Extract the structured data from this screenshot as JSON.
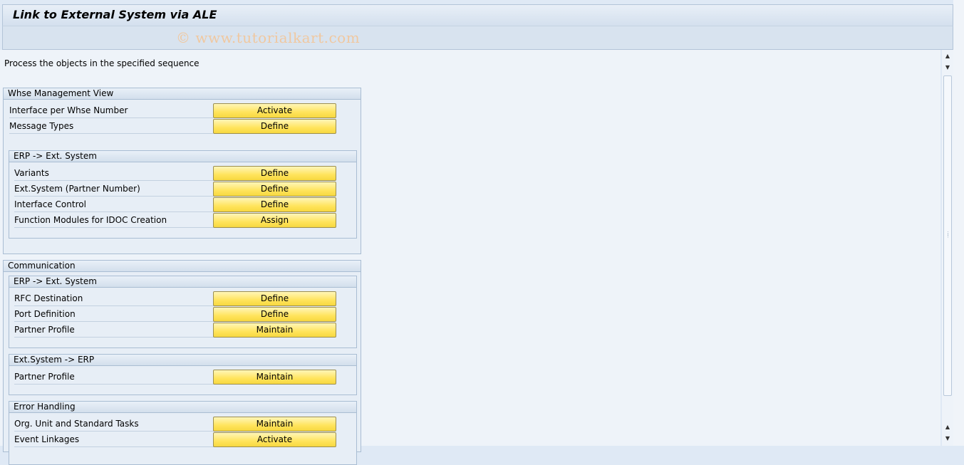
{
  "window": {
    "title": "Link to External System via ALE",
    "watermark": "© www.tutorialkart.com"
  },
  "content": {
    "instruction": "Process the objects in the specified sequence"
  },
  "groups": {
    "whse": {
      "title": "Whse Management View",
      "rows": [
        {
          "label": "Interface per Whse Number",
          "button": "Activate"
        },
        {
          "label": "Message Types",
          "button": "Define"
        }
      ],
      "erp_ext": {
        "title": "ERP -> Ext. System",
        "rows": [
          {
            "label": "Variants",
            "button": "Define"
          },
          {
            "label": "Ext.System (Partner Number)",
            "button": "Define"
          },
          {
            "label": "Interface Control",
            "button": "Define"
          },
          {
            "label": "Function Modules for IDOC Creation",
            "button": "Assign"
          }
        ]
      }
    },
    "communication": {
      "title": "Communication",
      "erp_ext": {
        "title": "ERP -> Ext. System",
        "rows": [
          {
            "label": "RFC Destination",
            "button": "Define"
          },
          {
            "label": "Port Definition",
            "button": "Define"
          },
          {
            "label": "Partner Profile",
            "button": "Maintain"
          }
        ]
      },
      "ext_erp": {
        "title": "Ext.System  -> ERP",
        "rows": [
          {
            "label": "Partner Profile",
            "button": "Maintain"
          }
        ]
      },
      "error_handling": {
        "title": "Error Handling",
        "rows": [
          {
            "label": "Org. Unit and Standard Tasks",
            "button": "Maintain"
          },
          {
            "label": "Event Linkages",
            "button": "Activate"
          }
        ]
      }
    }
  },
  "scrollbar": {
    "up_icon": "triangle-up",
    "down_icon": "triangle-down",
    "grip_icon": "grip-dots"
  }
}
